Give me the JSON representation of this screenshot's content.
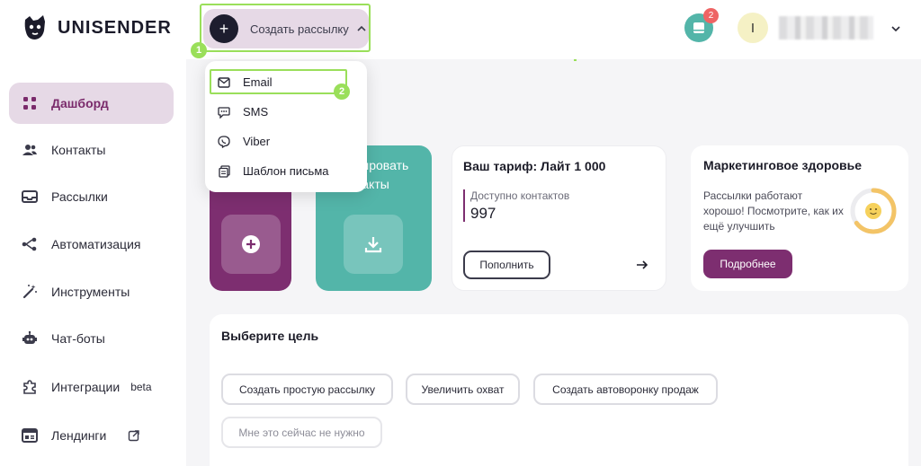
{
  "app": {
    "logo_text": "UNISENDER"
  },
  "header": {
    "create_label": "Создать рассылку",
    "notification_count": "2",
    "avatar_initial": "I"
  },
  "markers": {
    "first": "1",
    "second": "2"
  },
  "create_menu": {
    "items": [
      {
        "label": "Email",
        "icon": "envelope-icon"
      },
      {
        "label": "SMS",
        "icon": "chat-icon"
      },
      {
        "label": "Viber",
        "icon": "viber-icon"
      },
      {
        "label": "Шаблон письма",
        "icon": "template-icon"
      }
    ]
  },
  "sidebar": {
    "items": [
      {
        "label": "Дашборд",
        "icon": "grid-icon",
        "active": true
      },
      {
        "label": "Контакты",
        "icon": "users-icon"
      },
      {
        "label": "Рассылки",
        "icon": "mail-tray-icon"
      },
      {
        "label": "Автоматизация",
        "icon": "workflow-icon"
      },
      {
        "label": "Инструменты",
        "icon": "magic-wand-icon"
      },
      {
        "label": "Чат-боты",
        "icon": "robot-icon"
      },
      {
        "label": "Интеграции",
        "icon": "puzzle-icon",
        "badge": "beta"
      },
      {
        "label": "Лендинги",
        "icon": "landing-icon",
        "external": true
      }
    ]
  },
  "cards": {
    "import": {
      "text_line1": "тировать",
      "text_line2": "такты"
    },
    "tariff": {
      "title": "Ваш тариф: Лайт 1 000",
      "contacts_label": "Доступно контактов",
      "contacts_value": "997",
      "topup_label": "Пополнить"
    },
    "health": {
      "title": "Маркетинговое здоровье",
      "text": "Рассылки работают хорошо! Посмотрите, как их ещё улучшить",
      "more_label": "Подробнее",
      "score_fraction": 0.65
    }
  },
  "goals": {
    "title": "Выберите цель",
    "options": [
      "Создать простую рассылку",
      "Увеличить охват",
      "Создать автоворонку продаж",
      "Мне это сейчас не нужно"
    ]
  },
  "colors": {
    "accent_purple": "#7d2e70",
    "accent_teal": "#53b5a9",
    "highlight_green": "#9adf5a",
    "badge_red": "#ee6464"
  }
}
